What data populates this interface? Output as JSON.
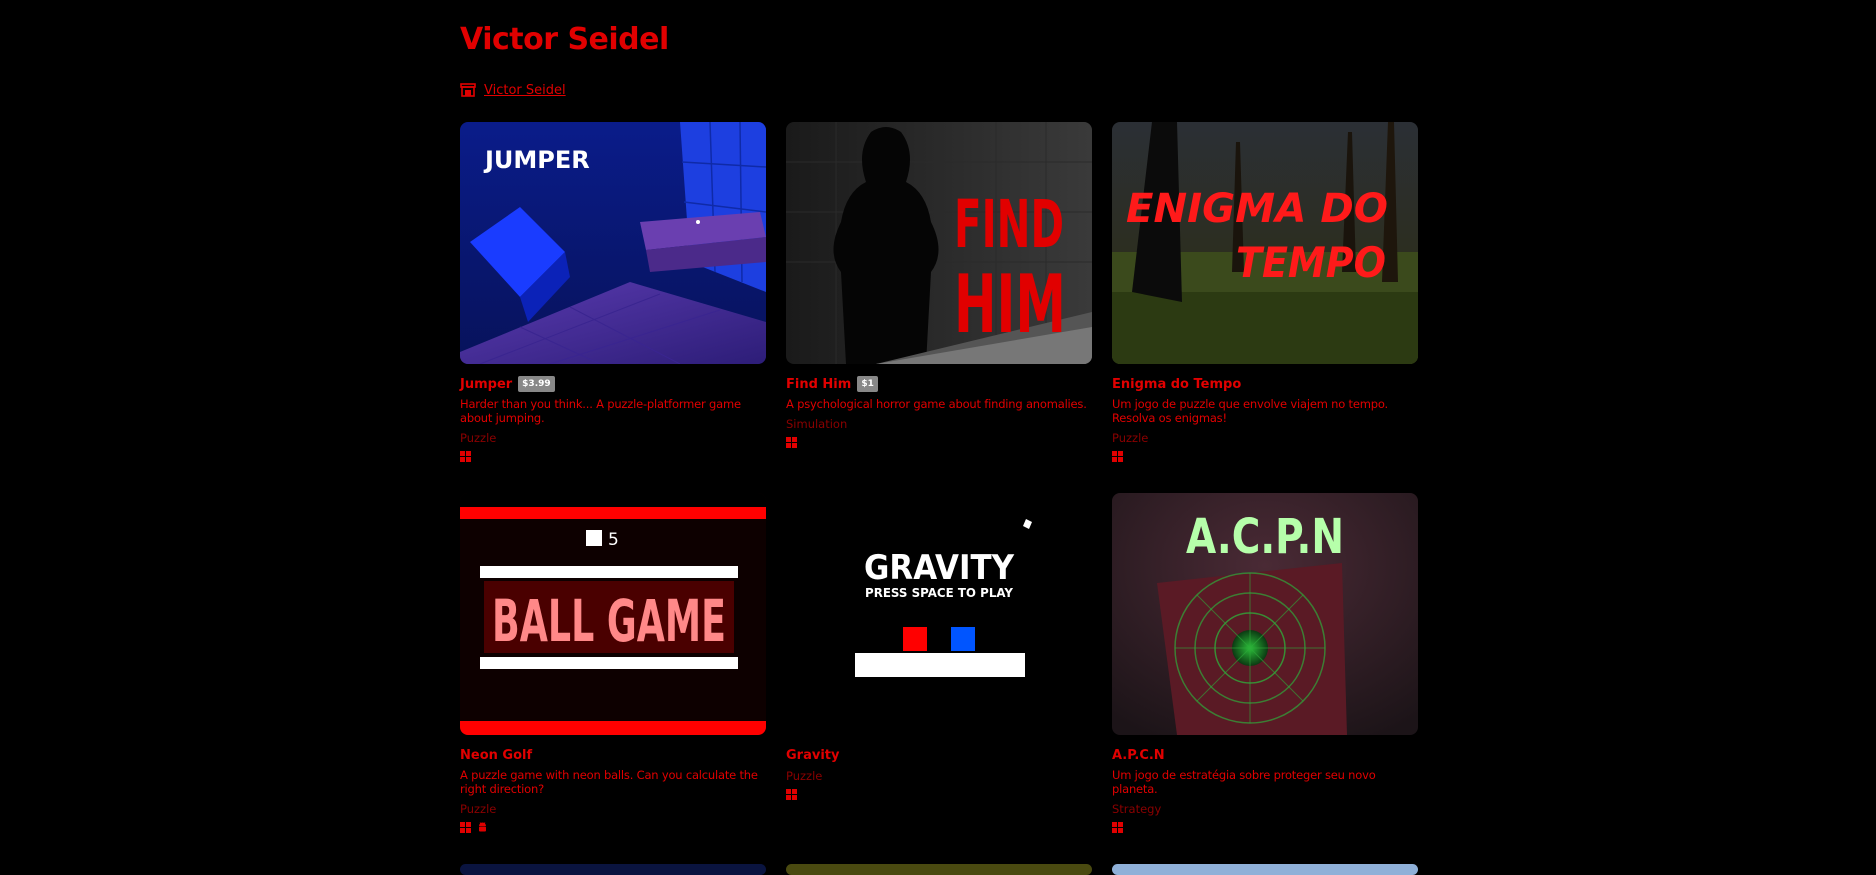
{
  "page": {
    "title": "Victor Seidel",
    "creator_link": "Victor Seidel"
  },
  "games": [
    {
      "title": "Jumper",
      "price": "$3.99",
      "description": "Harder than you think... A puzzle-platformer game about jumping.",
      "genre": "Puzzle",
      "platforms": [
        "windows"
      ]
    },
    {
      "title": "Find Him",
      "price": "$1",
      "description": "A psychological horror game about finding anomalies.",
      "genre": "Simulation",
      "platforms": [
        "windows"
      ]
    },
    {
      "title": "Enigma do Tempo",
      "description": "Um jogo de puzzle que envolve viajem no tempo. Resolva os enigmas!",
      "genre": "Puzzle",
      "platforms": [
        "windows"
      ]
    },
    {
      "title": "Neon Golf",
      "description": "A puzzle game with neon balls. Can you calculate the right direction?",
      "genre": "Puzzle",
      "platforms": [
        "windows",
        "android"
      ]
    },
    {
      "title": "Gravity",
      "genre": "Puzzle",
      "platforms": [
        "windows"
      ]
    },
    {
      "title": "A.P.C.N",
      "description": "Um jogo de estratégia sobre proteger seu novo planeta.",
      "genre": "Strategy",
      "platforms": [
        "windows"
      ]
    }
  ],
  "thumbnails": {
    "jumper": {
      "text": "JUMPER"
    },
    "find_him": {
      "line1": "FIND",
      "line2": "HIM"
    },
    "enigma": {
      "line1": "ENIGMA DO",
      "line2": "TEMPO"
    },
    "neon_golf": {
      "score": "5",
      "text": "BALL GAME"
    },
    "gravity": {
      "text": "GRAVITY",
      "subtext": "PRESS SPACE TO PLAY"
    },
    "apcn": {
      "text": "A.C.P.N"
    }
  },
  "colors": {
    "accent": "#e10000",
    "background": "#000000",
    "price_badge": "#888888"
  }
}
